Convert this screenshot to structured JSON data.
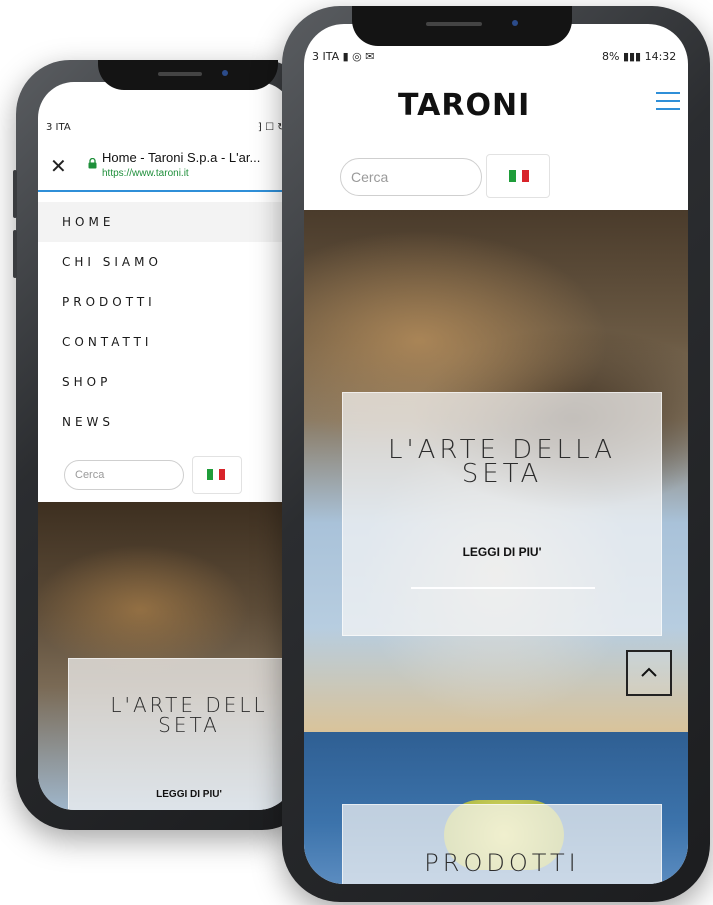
{
  "back_phone": {
    "status": {
      "left": "3 ITA",
      "right": "⁆ ☐ ↻"
    },
    "browser": {
      "close_label": "✕",
      "page_title": "Home - Taroni S.p.a - L'ar...",
      "url": "https://www.taroni.it"
    },
    "nav_items": [
      {
        "label": "HOME"
      },
      {
        "label": "CHI SIAMO"
      },
      {
        "label": "PRODOTTI"
      },
      {
        "label": "CONTATTI"
      },
      {
        "label": "SHOP"
      },
      {
        "label": "NEWS"
      }
    ],
    "search": {
      "placeholder": "Cerca"
    },
    "hero": {
      "title_line1": "L'ARTE DELL",
      "title_line2": "SETA",
      "link": "LEGGI DI PIU'"
    }
  },
  "front_phone": {
    "status": {
      "left": "3 ITA ▮ ◎ ✉",
      "right": "8% ▮▮▮ 14:32"
    },
    "logo": "TARONI",
    "search": {
      "placeholder": "Cerca"
    },
    "hero": {
      "title_line1": "L'ARTE DELLA",
      "title_line2": "SETA",
      "link": "LEGGI DI PIU'"
    },
    "section": {
      "title": "PRODOTTI"
    }
  },
  "colors": {
    "accent": "#2f8fd8",
    "lock": "#1e8f3a",
    "flag_green": "#1f9d3a",
    "flag_red": "#d8232a"
  },
  "icons": [
    "lock-icon",
    "close-icon",
    "hamburger-icon",
    "italy-flag-icon",
    "chevron-up-icon"
  ]
}
